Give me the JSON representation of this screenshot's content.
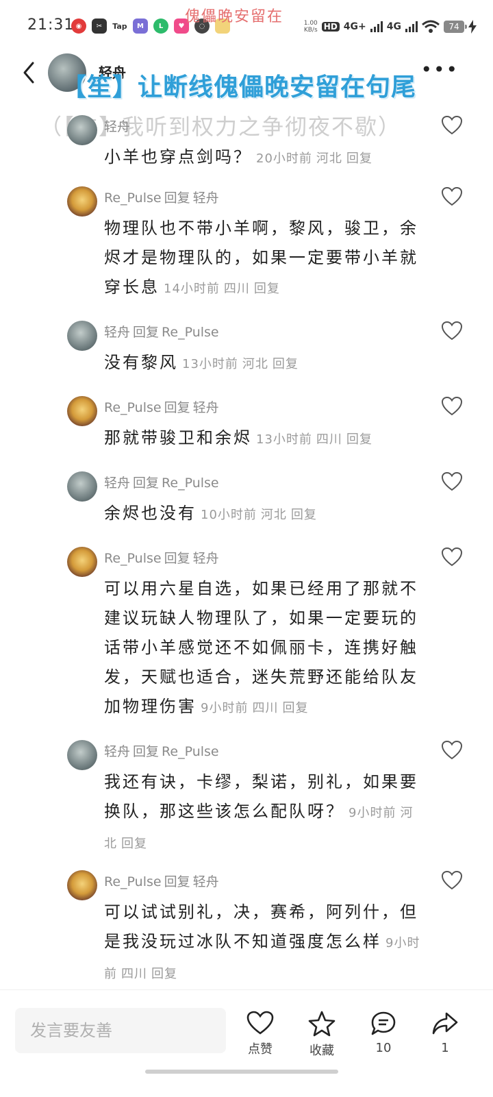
{
  "status_bar": {
    "time": "21:31",
    "ticker_top": "傀儡晚安留在",
    "speed": "1.00\nKB/s",
    "hd": "HD",
    "net1": "4G+",
    "net2": "4G",
    "battery": "74",
    "app_icons": [
      "netease-music-icon",
      "capcut-icon",
      "taptap-icon",
      "app-icon",
      "app-icon",
      "app-icon",
      "wechat-icon",
      "avatar-icon"
    ]
  },
  "header": {
    "title": "轻舟",
    "overlay_line1": "【笙】让断线傀儡晚安留在句尾",
    "overlay_line2": "（【玄】我听到权力之争彻夜不歇）"
  },
  "comments": [
    {
      "author": "轻舟",
      "reply_word": "回复",
      "target": "",
      "text": "小羊也穿点剑吗？",
      "time": "20小时前",
      "location": "河北",
      "reply_label": "回复",
      "avatar": "qingzhou"
    },
    {
      "author": "Re_Pulse",
      "reply_word": "回复",
      "target": "轻舟",
      "text": "物理队也不带小羊啊，黎风，骏卫，余烬才是物理队的，如果一定要带小羊就穿长息",
      "time": "14小时前",
      "location": "四川",
      "reply_label": "回复",
      "avatar": "repulse"
    },
    {
      "author": "轻舟",
      "reply_word": "回复",
      "target": "Re_Pulse",
      "text": "没有黎风",
      "time": "13小时前",
      "location": "河北",
      "reply_label": "回复",
      "avatar": "qingzhou"
    },
    {
      "author": "Re_Pulse",
      "reply_word": "回复",
      "target": "轻舟",
      "text": "那就带骏卫和余烬",
      "time": "13小时前",
      "location": "四川",
      "reply_label": "回复",
      "avatar": "repulse"
    },
    {
      "author": "轻舟",
      "reply_word": "回复",
      "target": "Re_Pulse",
      "text": "余烬也没有",
      "time": "10小时前",
      "location": "河北",
      "reply_label": "回复",
      "avatar": "qingzhou"
    },
    {
      "author": "Re_Pulse",
      "reply_word": "回复",
      "target": "轻舟",
      "text": "可以用六星自选，如果已经用了那就不建议玩缺人物理队了，如果一定要玩的话带小羊感觉还不如佩丽卡，连携好触发，天赋也适合，迷失荒野还能给队友加物理伤害",
      "time": "9小时前",
      "location": "四川",
      "reply_label": "回复",
      "avatar": "repulse"
    },
    {
      "author": "轻舟",
      "reply_word": "回复",
      "target": "Re_Pulse",
      "text": "我还有诀，卡缪，梨诺，别礼，如果要换队，那这些该怎么配队呀？",
      "time": "9小时前",
      "location": "河北",
      "reply_label": "回复",
      "avatar": "qingzhou"
    },
    {
      "author": "Re_Pulse",
      "reply_word": "回复",
      "target": "轻舟",
      "text": "可以试试别礼，决，赛希，阿列什，但是我没玩过冰队不知道强度怎么样",
      "time": "9小时前",
      "location": "四川",
      "reply_label": "回复",
      "avatar": "repulse"
    }
  ],
  "bottom_bar": {
    "input_placeholder": "发言要友善",
    "like_label": "点赞",
    "collect_label": "收藏",
    "comment_count": "10",
    "share_count": "1"
  }
}
